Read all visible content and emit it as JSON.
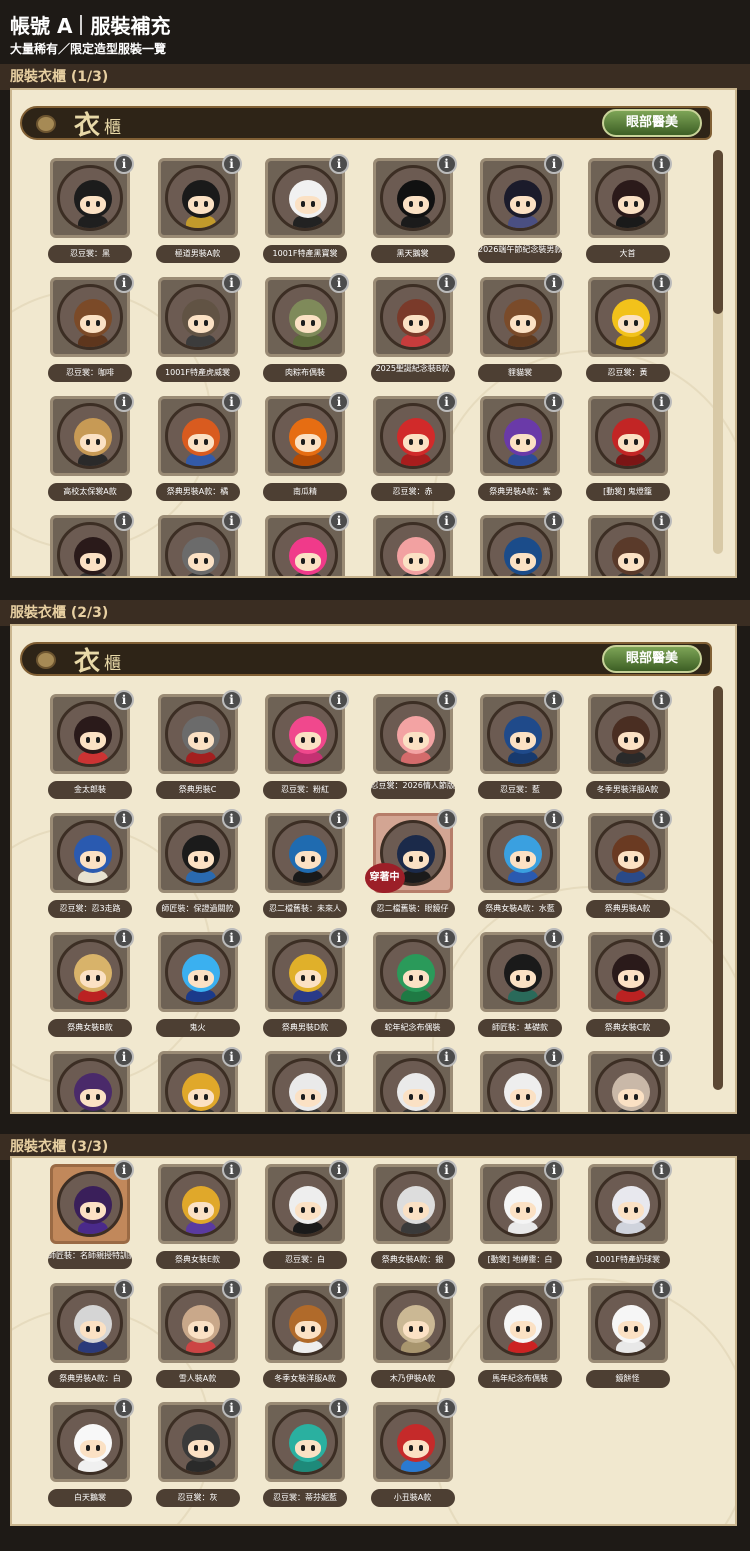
{
  "header": {
    "title_left": "帳號 A",
    "title_right": "服裝補充",
    "subtitle": "大量稀有／限定造型服裝一覽"
  },
  "sections": [
    {
      "label": "服裝衣櫃 (1/3)",
      "tab_icon": "衣",
      "tab_title": "櫃",
      "tab_button": "眼部醫美",
      "items": [
        {
          "name": "忍豆裳：黑",
          "hair": "#1c1c1c",
          "bodycol": "#1f1f1f"
        },
        {
          "name": "極道男裝A款",
          "hair": "#1a1a1a",
          "bodycol": "#c29a2b"
        },
        {
          "name": "1001F特產黑寶裳",
          "hair": "#f1f1f1",
          "bodycol": "#222"
        },
        {
          "name": "黑天鵝裳",
          "hair": "#111",
          "bodycol": "#1b1b1b"
        },
        {
          "name": "2026端午節紀念裝男款",
          "hair": "#1b1b2b",
          "bodycol": "#4a4f82"
        },
        {
          "name": "大首",
          "hair": "#2b1a1a",
          "bodycol": "#1a1a1a"
        },
        {
          "name": "忍豆裳：咖啡",
          "hair": "#7b4a28",
          "bodycol": "#5e361d"
        },
        {
          "name": "1001F特產虎威裳",
          "hair": "#615344",
          "bodycol": "#3c3c3c"
        },
        {
          "name": "肉粽布偶裝",
          "hair": "#7f8a5a",
          "bodycol": "#5c6a3a"
        },
        {
          "name": "2025聖誕紀念裝B款",
          "hair": "#7a3a2a",
          "bodycol": "#c73c3c"
        },
        {
          "name": "貍貓裳",
          "hair": "#7a4b2a",
          "bodycol": "#5f3a1f"
        },
        {
          "name": "忍豆裳：黃",
          "hair": "#f2c21b",
          "bodycol": "#d6a400"
        },
        {
          "name": "高校太保裳A款",
          "hair": "#c79a55",
          "bodycol": "#2a2a2a"
        },
        {
          "name": "祭典男裝A款：橘",
          "hair": "#d95b1f",
          "bodycol": "#335aa8"
        },
        {
          "name": "南瓜精",
          "hair": "#e66d12",
          "bodycol": "#b24b05"
        },
        {
          "name": "忍豆裳：赤",
          "hair": "#d12a2a",
          "bodycol": "#a81d1d"
        },
        {
          "name": "祭典男裝A款：紫",
          "hair": "#6a3aa8",
          "bodycol": "#2d4c98"
        },
        {
          "name": "[動裳] 鬼燈籠",
          "hair": "#c22525",
          "bodycol": "#7b1515"
        },
        {
          "name": "",
          "hair": "#2a1a1a",
          "bodycol": "#333"
        },
        {
          "name": "",
          "hair": "#6b6b6b",
          "bodycol": "#333"
        },
        {
          "name": "",
          "hair": "#f03a8a",
          "bodycol": "#333"
        },
        {
          "name": "",
          "hair": "#f2a1a1",
          "bodycol": "#333"
        },
        {
          "name": "",
          "hair": "#1b4c8a",
          "bodycol": "#333"
        },
        {
          "name": "",
          "hair": "#5a3a2a",
          "bodycol": "#333"
        }
      ]
    },
    {
      "label": "服裝衣櫃 (2/3)",
      "tab_icon": "衣",
      "tab_title": "櫃",
      "tab_button": "眼部醫美",
      "items": [
        {
          "name": "金太郎裝",
          "hair": "#2a1a1a",
          "bodycol": "#c33"
        },
        {
          "name": "祭典男裝C",
          "hair": "#6b6b6b",
          "bodycol": "#a31f1f"
        },
        {
          "name": "忍豆裳：粉紅",
          "hair": "#f0488d",
          "bodycol": "#c43172"
        },
        {
          "name": "忍豆裳：2026情人節版",
          "hair": "#f3a3a3",
          "bodycol": "#d36b6b"
        },
        {
          "name": "忍豆裳：藍",
          "hair": "#1f4a8a",
          "bodycol": "#173a6e"
        },
        {
          "name": "冬季男裝洋服A款",
          "hair": "#4a2e22",
          "bodycol": "#2a2a2a"
        },
        {
          "name": "忍豆裳：忍3走路",
          "hair": "#2a5ab0",
          "bodycol": "#e8e2d0"
        },
        {
          "name": "師匠裝：保證過關款",
          "hair": "#1b1b1b",
          "bodycol": "#2a6ab0"
        },
        {
          "name": "忍二檔舊裝：未來人",
          "hair": "#1f6bb0",
          "bodycol": "#1a1a1a"
        },
        {
          "name": "忍二檔舊裝：眼鏡仔",
          "hair": "#1b2a4a",
          "bodycol": "#1a1a1a"
        },
        {
          "name": "祭典女裝A款：水藍",
          "hair": "#3aa0e0",
          "bodycol": "#2a5ab0"
        },
        {
          "name": "祭典男裝A款",
          "hair": "#6a3a22",
          "bodycol": "#2a4a88"
        },
        {
          "name": "祭典女裝B款",
          "hair": "#d8b36a",
          "bodycol": "#b22"
        },
        {
          "name": "鬼火",
          "hair": "#3ab0f0",
          "bodycol": "#1b3a8a"
        },
        {
          "name": "祭典男裝D款",
          "hair": "#e0b02a",
          "bodycol": "#2a3a88"
        },
        {
          "name": "蛇年紀念布偶裝",
          "hair": "#2a9a5a",
          "bodycol": "#1f7a44"
        },
        {
          "name": "師匠裝：基礎款",
          "hair": "#1a1a1a",
          "bodycol": "#2a6a5a"
        },
        {
          "name": "祭典女裝C款",
          "hair": "#2a1a1a",
          "bodycol": "#b22"
        },
        {
          "name": "",
          "hair": "#4a2a6a",
          "bodycol": "#333"
        },
        {
          "name": "",
          "hair": "#e0a82a",
          "bodycol": "#333"
        },
        {
          "name": "",
          "hair": "#eaeaea",
          "bodycol": "#333"
        },
        {
          "name": "",
          "hair": "#eaeaea",
          "bodycol": "#333"
        },
        {
          "name": "",
          "hair": "#eee",
          "bodycol": "#333"
        },
        {
          "name": "",
          "hair": "#c9b8a8",
          "bodycol": "#333"
        }
      ]
    },
    {
      "label": "服裝衣櫃 (3/3)",
      "items": [
        {
          "name": "師匠裝：名師親授特訓款",
          "hair": "#3a1f5a",
          "bodycol": "#4a2a8a"
        },
        {
          "name": "祭典女裝E款",
          "hair": "#e0a82a",
          "bodycol": "#5a3aa0"
        },
        {
          "name": "忍豆裳：白",
          "hair": "#eeeeee",
          "bodycol": "#1a1a1a"
        },
        {
          "name": "祭典女裝A款：銀",
          "hair": "#dddddd",
          "bodycol": "#3a3a3a"
        },
        {
          "name": "[動裳] 地縛靈：白",
          "hair": "#f5f5f5",
          "bodycol": "#e9e9e9"
        },
        {
          "name": "1001F特產奶球裳",
          "hair": "#e8e8ee",
          "bodycol": "#cfd3dc"
        },
        {
          "name": "祭典男裝A款：白",
          "hair": "#d5d5d5",
          "bodycol": "#2a3a7a"
        },
        {
          "name": "雪人裝A款",
          "hair": "#c9a88a",
          "bodycol": "#c44"
        },
        {
          "name": "冬季女裝洋服A款",
          "hair": "#b06a2a",
          "bodycol": "#eee"
        },
        {
          "name": "木乃伊裝A款",
          "hair": "#cbb894",
          "bodycol": "#a8956e"
        },
        {
          "name": "馬年紀念布偶裝",
          "hair": "#f5f5f5",
          "bodycol": "#c22"
        },
        {
          "name": "鏡餅怪",
          "hair": "#f6f6f6",
          "bodycol": "#e8e8e8"
        },
        {
          "name": "白天鵝裳",
          "hair": "#f8f8f8",
          "bodycol": "#f0f0f0"
        },
        {
          "name": "忍豆裳：灰",
          "hair": "#3a3a3a",
          "bodycol": "#2a2a2a"
        },
        {
          "name": "忍豆裳：蒂芬妮藍",
          "hair": "#2ab0a0",
          "bodycol": "#1e8a7a"
        },
        {
          "name": "小丑裝A款",
          "hair": "#c52a2a",
          "bodycol": "#2a7ad0"
        }
      ]
    }
  ],
  "worn_badge": "穿著中"
}
